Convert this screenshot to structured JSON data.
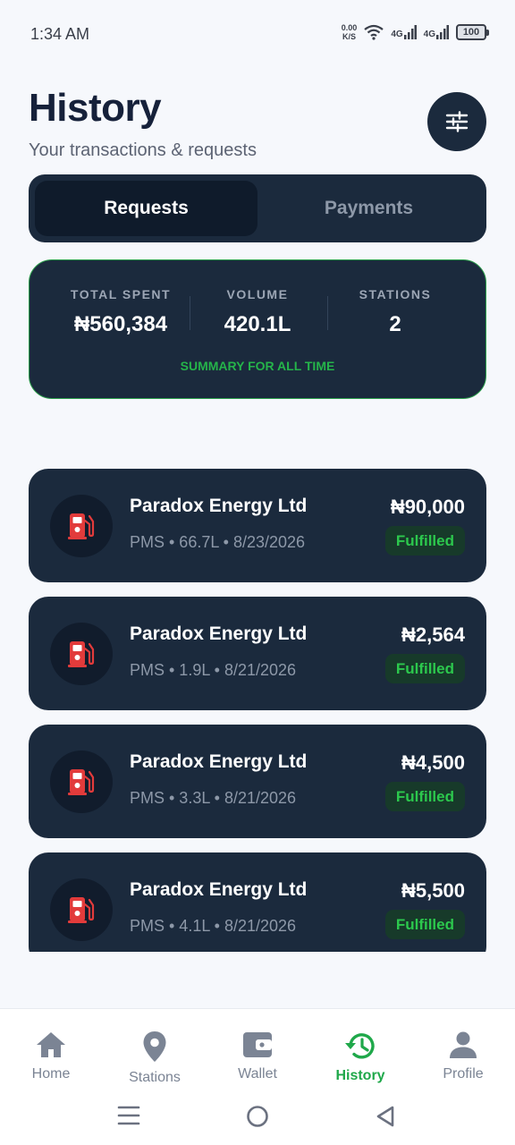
{
  "status_bar": {
    "time": "1:34 AM",
    "speed_value": "0.00",
    "speed_unit": "K/S",
    "net1": "4G",
    "net2": "4G",
    "battery": "100"
  },
  "header": {
    "title": "History",
    "subtitle": "Your transactions & requests",
    "filter_icon": "sliders-icon"
  },
  "tabs": [
    {
      "label": "Requests",
      "active": true
    },
    {
      "label": "Payments",
      "active": false
    }
  ],
  "summary": {
    "stats": [
      {
        "label": "TOTAL SPENT",
        "value": "₦560,384"
      },
      {
        "label": "VOLUME",
        "value": "420.1L"
      },
      {
        "label": "STATIONS",
        "value": "2"
      }
    ],
    "note": "SUMMARY FOR ALL TIME"
  },
  "transactions": [
    {
      "station": "Paradox Energy Ltd",
      "details": "PMS • 66.7L • 8/23/2026",
      "amount": "₦90,000",
      "status": "Fulfilled"
    },
    {
      "station": "Paradox Energy Ltd",
      "details": "PMS • 1.9L • 8/21/2026",
      "amount": "₦2,564",
      "status": "Fulfilled"
    },
    {
      "station": "Paradox Energy Ltd",
      "details": "PMS • 3.3L • 8/21/2026",
      "amount": "₦4,500",
      "status": "Fulfilled"
    },
    {
      "station": "Paradox Energy Ltd",
      "details": "PMS • 4.1L • 8/21/2026",
      "amount": "₦5,500",
      "status": "Fulfilled"
    }
  ],
  "bottom_nav": [
    {
      "label": "Home",
      "icon": "home-icon",
      "active": false
    },
    {
      "label": "Stations",
      "icon": "map-pin-icon",
      "active": false
    },
    {
      "label": "Wallet",
      "icon": "wallet-icon",
      "active": false
    },
    {
      "label": "History",
      "icon": "history-icon",
      "active": true
    },
    {
      "label": "Profile",
      "icon": "profile-icon",
      "active": false
    }
  ],
  "colors": {
    "accent": "#1fa84a",
    "card": "#1b2a3d",
    "background": "#f6f8fc",
    "fuel_red": "#e23b3b"
  }
}
